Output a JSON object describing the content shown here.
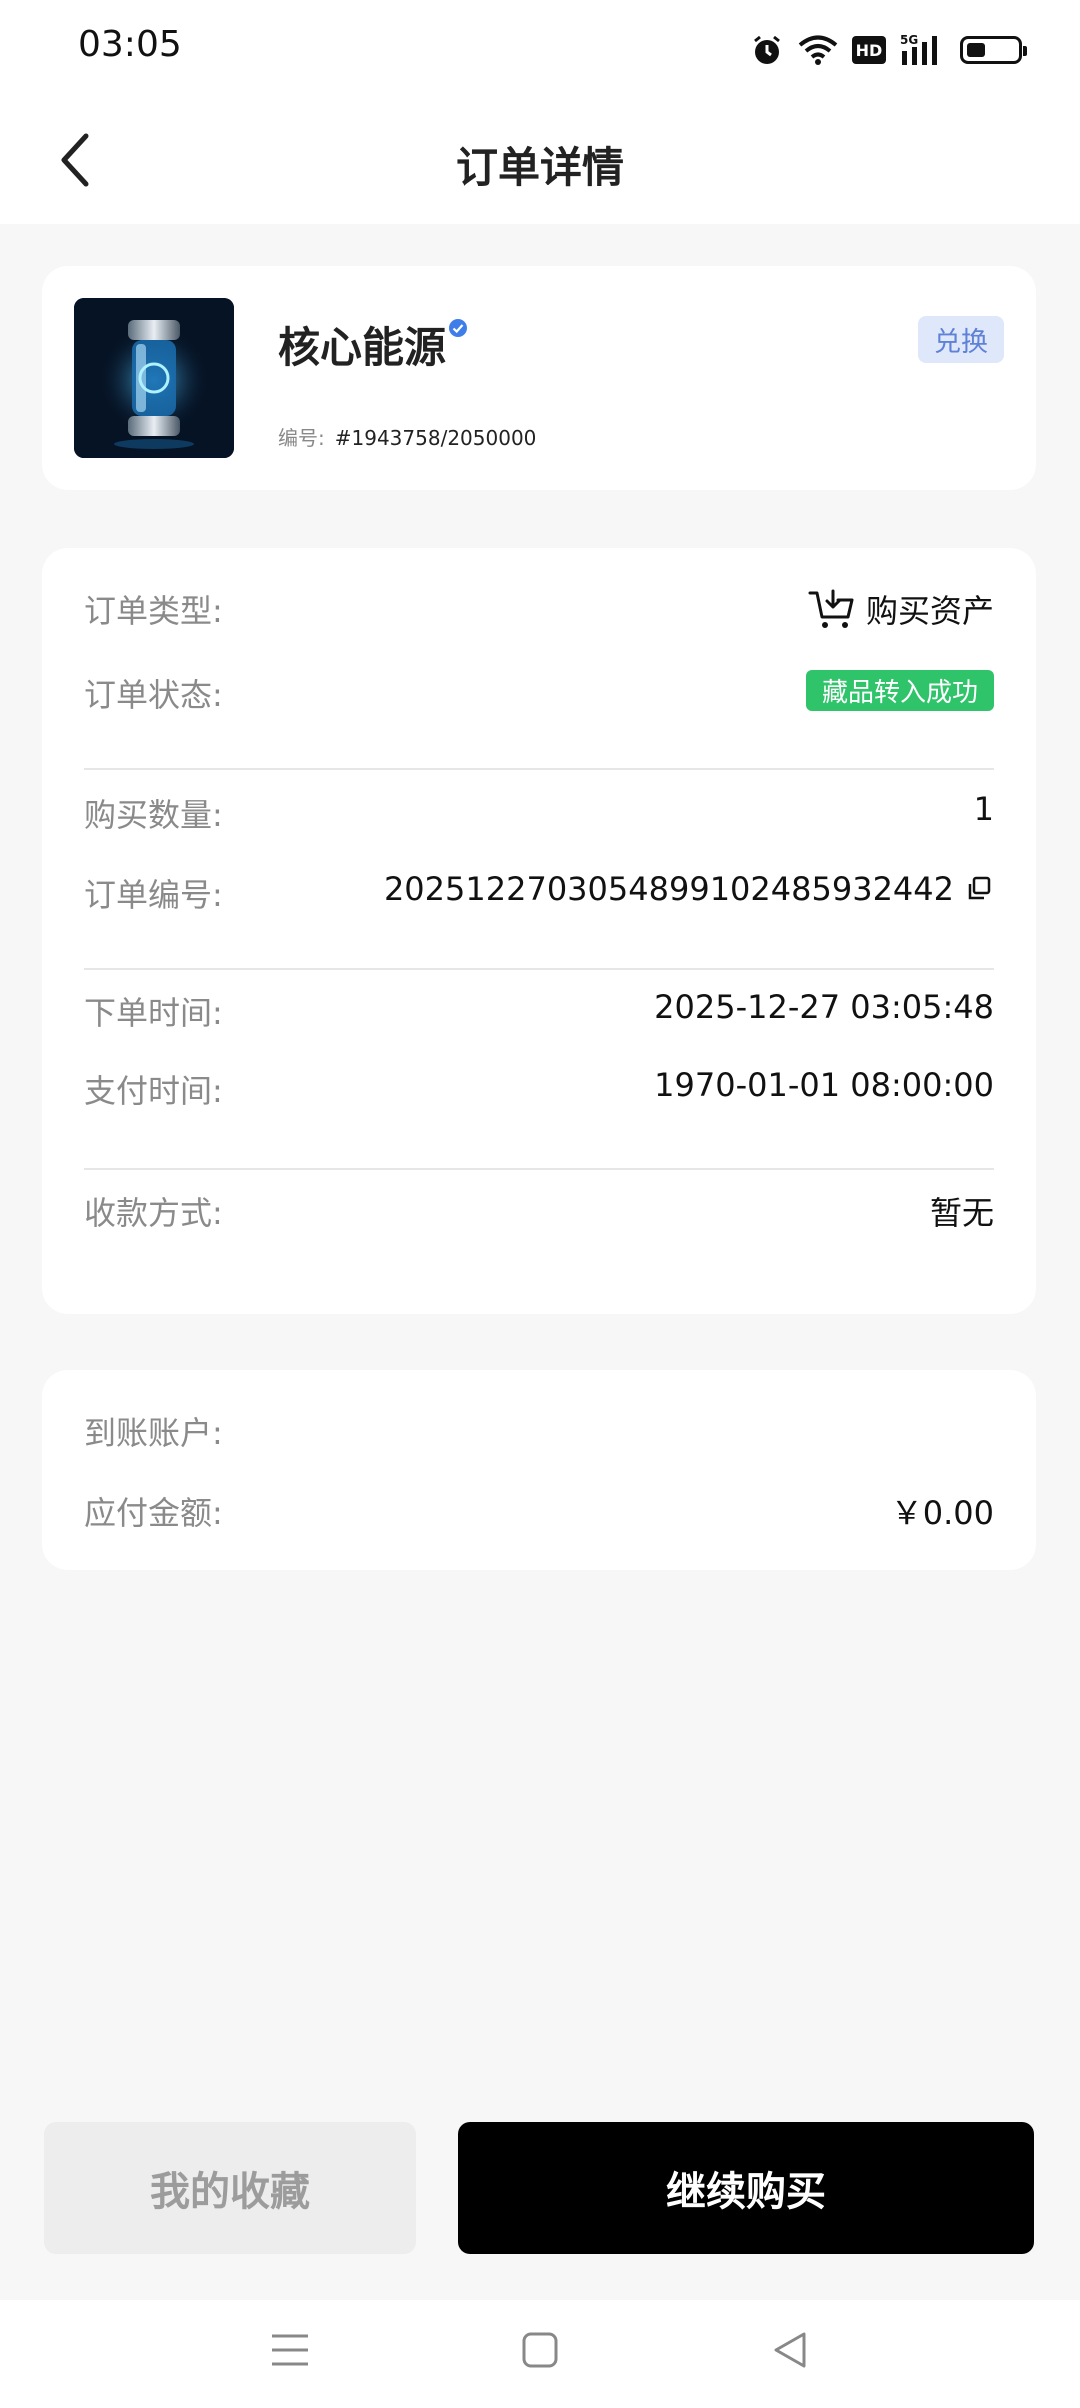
{
  "status_bar": {
    "time": "03:05",
    "icons": [
      "alarm-icon",
      "wifi-icon",
      "hd-icon",
      "5g-signal-icon",
      "battery-icon"
    ],
    "hd_label": "HD"
  },
  "header": {
    "title": "订单详情"
  },
  "product": {
    "name": "核心能源",
    "tag": "兑换",
    "serial_label": "编号:",
    "serial_value": "#1943758/2050000"
  },
  "details": {
    "order_type_label": "订单类型:",
    "order_type_value": "购买资产",
    "order_status_label": "订单状态:",
    "order_status_value": "藏品转入成功",
    "quantity_label": "购买数量:",
    "quantity_value": "1",
    "order_no_label": "订单编号:",
    "order_no_value": "20251227030548991024859324​42",
    "order_time_label": "下单时间:",
    "order_time_value": "2025-12-27 03:05:48",
    "pay_time_label": "支付时间:",
    "pay_time_value": "1970-01-01 08:00:00",
    "payment_method_label": "收款方式:",
    "payment_method_value": "暂无"
  },
  "payment": {
    "account_label": "到账账户:",
    "account_value": "",
    "amount_label": "应付金额:",
    "amount_value": "￥0.00"
  },
  "actions": {
    "favorites_label": "我的收藏",
    "continue_label": "继续购买"
  },
  "colors": {
    "success": "#2fc36a",
    "tag_bg": "#dfe8fb",
    "tag_text": "#5f82d6",
    "primary_button": "#000000"
  }
}
